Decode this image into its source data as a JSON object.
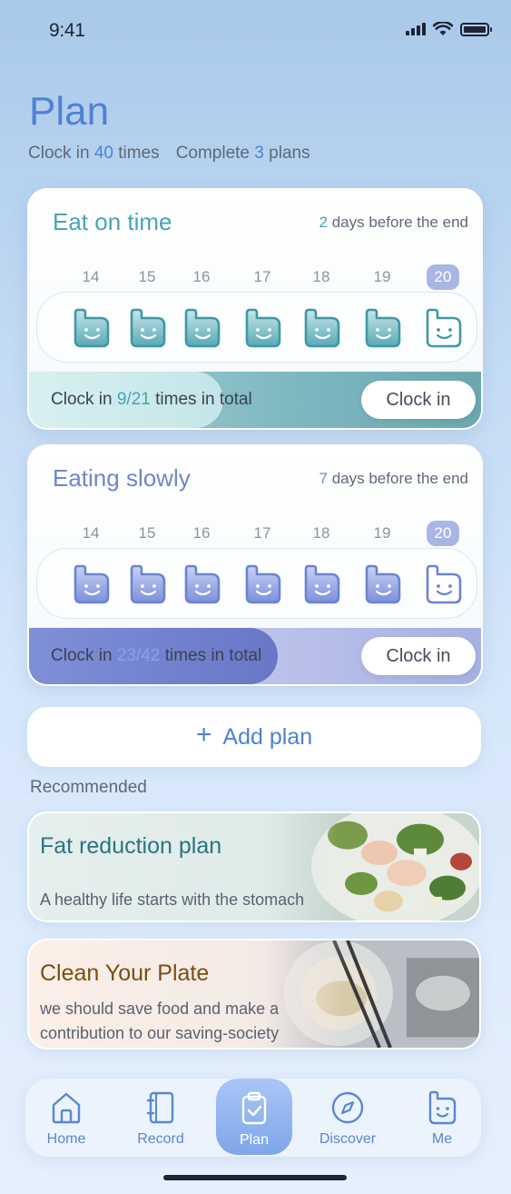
{
  "status_bar": {
    "time": "9:41"
  },
  "header": {
    "title": "Plan",
    "clock_in_prefix": "Clock in",
    "clock_in_count": "40",
    "clock_in_suffix": "times",
    "complete_prefix": "Complete",
    "complete_count": "3",
    "complete_suffix": "plans"
  },
  "plans": [
    {
      "name": "Eat on time",
      "days_left": "2",
      "days_left_suffix": "days before the end",
      "dates": [
        "14",
        "15",
        "16",
        "17",
        "18",
        "19",
        "20"
      ],
      "today": "20",
      "progress_prefix": "Clock in",
      "progress_value": "9/21",
      "progress_suffix": "times in total",
      "progress_fraction": 0.43,
      "button_label": "Clock in",
      "accent_color": "#4aa3b2"
    },
    {
      "name": "Eating slowly",
      "days_left": "7",
      "days_left_suffix": "days before the end",
      "dates": [
        "14",
        "15",
        "16",
        "17",
        "18",
        "19",
        "20"
      ],
      "today": "20",
      "progress_prefix": "Clock in",
      "progress_value": "23/42",
      "progress_suffix": "times in total",
      "progress_fraction": 0.55,
      "button_label": "Clock in",
      "accent_color": "#6f86c9"
    }
  ],
  "add_plan": {
    "label": "Add plan",
    "icon": "plus-icon"
  },
  "recommended": {
    "title": "Recommended",
    "items": [
      {
        "name": "Fat reduction plan",
        "description": "A healthy life starts with the stomach",
        "image": "salad-image"
      },
      {
        "name": "Clean Your Plate",
        "description": "we should save food and make a contribution to our saving-society",
        "image": "bowl-image"
      }
    ]
  },
  "tabs": [
    {
      "label": "Home",
      "icon": "home-icon"
    },
    {
      "label": "Record",
      "icon": "notebook-icon"
    },
    {
      "label": "Plan",
      "icon": "clipboard-check-icon",
      "active": true
    },
    {
      "label": "Discover",
      "icon": "compass-icon"
    },
    {
      "label": "Me",
      "icon": "smile-face-icon"
    }
  ]
}
